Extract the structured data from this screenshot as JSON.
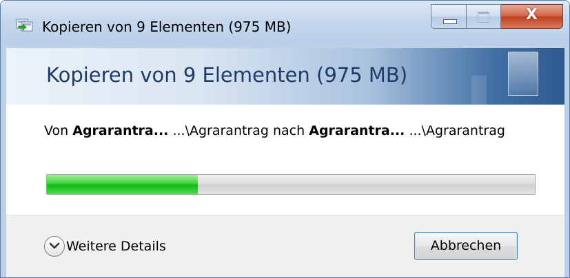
{
  "window": {
    "title": "Kopieren von 9 Elementen (975 MB)",
    "icon": "copy-files-icon",
    "caption": {
      "minimize_icon": "minimize-icon",
      "maximize_icon": "maximize-icon",
      "close_label": "X"
    }
  },
  "header": {
    "title": "Kopieren von 9 Elementen (975 MB)"
  },
  "transfer": {
    "from_word": "Von",
    "source_name": "Agrarantra...",
    "source_path": "...\\Agrarantrag",
    "to_word": "nach",
    "dest_name": "Agrarantra...",
    "dest_path": "...\\Agrarantrag"
  },
  "progress": {
    "fraction": 0.31,
    "color_fill": "#10b81c",
    "color_track": "#dcdcdc"
  },
  "footer": {
    "details_label": "Weitere Details",
    "details_icon": "chevron-down-icon",
    "cancel_label": "Abbrechen"
  },
  "colors": {
    "header_text": "#1f3b66",
    "close_button": "#c0421f",
    "accent_border": "#3c7fb1"
  }
}
